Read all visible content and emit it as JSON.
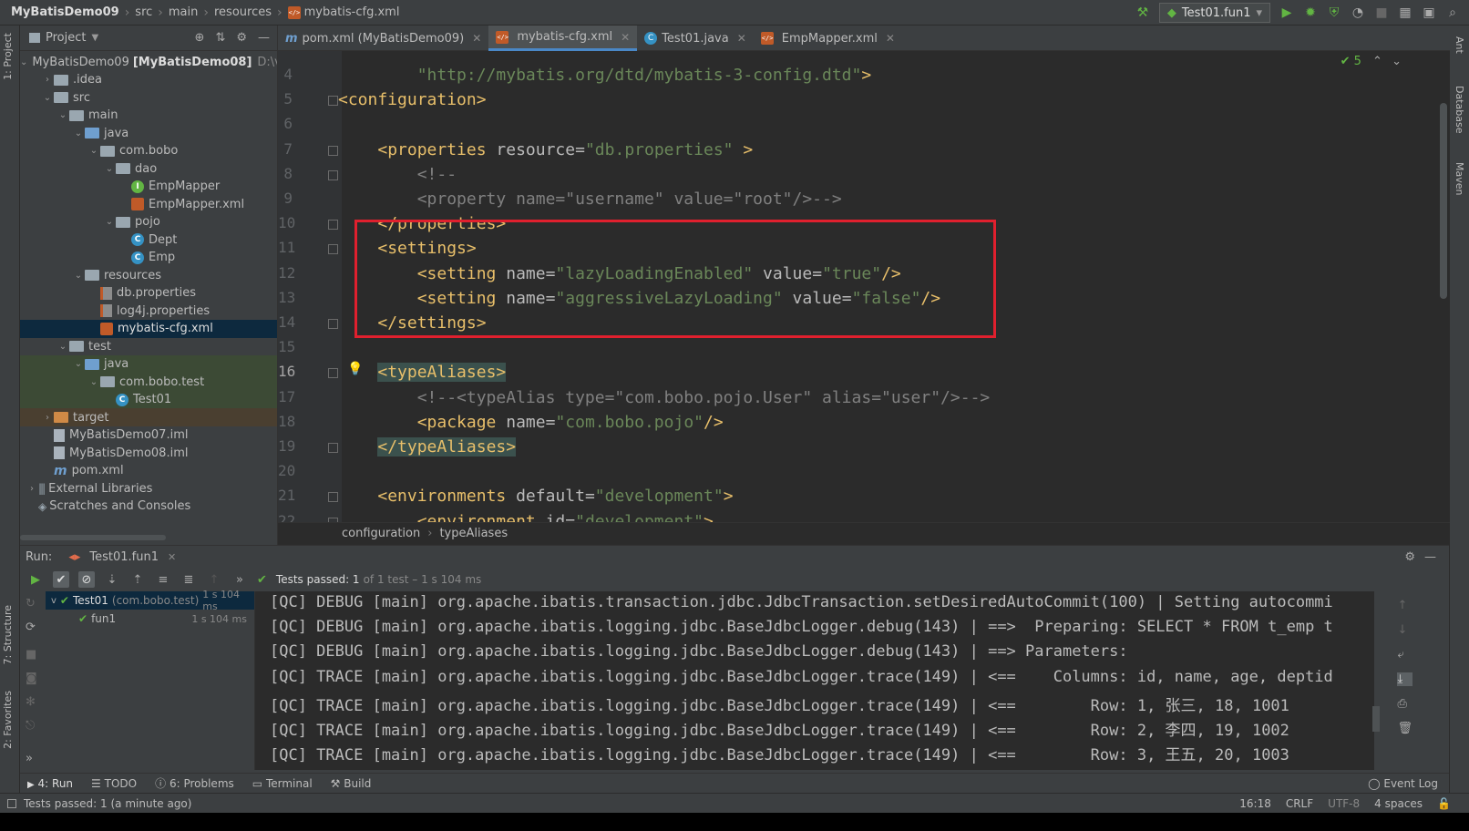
{
  "navbar": {
    "crumbs": [
      "MyBatisDemo09",
      "src",
      "main",
      "resources",
      "mybatis-cfg.xml"
    ],
    "run_config": "Test01.fun1"
  },
  "left_strip": {
    "project_tab": "1: Project",
    "structure_tab": "7: Structure",
    "favorites_tab": "2: Favorites"
  },
  "right_strip": {
    "ant_tab": "Ant",
    "database_tab": "Database",
    "maven_tab": "Maven"
  },
  "project": {
    "title": "Project",
    "tree": [
      {
        "label": "MyBatisDemo09",
        "bold_suffix": "[MyBatisDemo08]",
        "hint": "D:\\v",
        "depth": 0,
        "icon": "folder",
        "arrow": "v"
      },
      {
        "label": ".idea",
        "depth": 1,
        "icon": "folder",
        "arrow": ">"
      },
      {
        "label": "src",
        "depth": 1,
        "icon": "folder",
        "arrow": "v"
      },
      {
        "label": "main",
        "depth": 2,
        "icon": "folder",
        "arrow": "v"
      },
      {
        "label": "java",
        "depth": 3,
        "icon": "folder-blue",
        "arrow": "v"
      },
      {
        "label": "com.bobo",
        "depth": 4,
        "icon": "package",
        "arrow": "v"
      },
      {
        "label": "dao",
        "depth": 5,
        "icon": "package",
        "arrow": "v"
      },
      {
        "label": "EmpMapper",
        "depth": 6,
        "icon": "interface",
        "arrow": ""
      },
      {
        "label": "EmpMapper.xml",
        "depth": 6,
        "icon": "xml",
        "arrow": ""
      },
      {
        "label": "pojo",
        "depth": 5,
        "icon": "package",
        "arrow": "v"
      },
      {
        "label": "Dept",
        "depth": 6,
        "icon": "class",
        "arrow": ""
      },
      {
        "label": "Emp",
        "depth": 6,
        "icon": "class",
        "arrow": ""
      },
      {
        "label": "resources",
        "depth": 3,
        "icon": "folder-res",
        "arrow": "v"
      },
      {
        "label": "db.properties",
        "depth": 4,
        "icon": "properties",
        "arrow": ""
      },
      {
        "label": "log4j.properties",
        "depth": 4,
        "icon": "properties",
        "arrow": ""
      },
      {
        "label": "mybatis-cfg.xml",
        "depth": 4,
        "icon": "xml",
        "arrow": "",
        "selected": true
      },
      {
        "label": "test",
        "depth": 2,
        "icon": "folder",
        "arrow": "v"
      },
      {
        "label": "java",
        "depth": 3,
        "icon": "folder-green",
        "arrow": "v",
        "highlight": "green"
      },
      {
        "label": "com.bobo.test",
        "depth": 4,
        "icon": "package",
        "arrow": "v",
        "highlight": "green"
      },
      {
        "label": "Test01",
        "depth": 5,
        "icon": "class",
        "arrow": "",
        "highlight": "green"
      },
      {
        "label": "target",
        "depth": 1,
        "icon": "folder-orange",
        "arrow": ">",
        "highlight": "brown"
      },
      {
        "label": "MyBatisDemo07.iml",
        "depth": 1,
        "icon": "iml",
        "arrow": ""
      },
      {
        "label": "MyBatisDemo08.iml",
        "depth": 1,
        "icon": "iml",
        "arrow": ""
      },
      {
        "label": "pom.xml",
        "depth": 1,
        "icon": "maven",
        "arrow": ""
      },
      {
        "label": "External Libraries",
        "depth": 0,
        "icon": "library",
        "arrow": ">"
      },
      {
        "label": "Scratches and Consoles",
        "depth": 0,
        "icon": "scratch",
        "arrow": ""
      }
    ]
  },
  "editor": {
    "tabs": [
      {
        "label": "pom.xml (MyBatisDemo09)",
        "icon": "maven"
      },
      {
        "label": "mybatis-cfg.xml",
        "icon": "xml",
        "active": true
      },
      {
        "label": "Test01.java",
        "icon": "class"
      },
      {
        "label": "EmpMapper.xml",
        "icon": "xml"
      }
    ],
    "inspections": "5",
    "lines": [
      {
        "n": "4",
        "text": "        \"http://mybatis.org/dtd/mybatis-3-config.dtd\">"
      },
      {
        "n": "5",
        "text": "<configuration>"
      },
      {
        "n": "6",
        "text": ""
      },
      {
        "n": "7",
        "text": "    <properties resource=\"db.properties\" >"
      },
      {
        "n": "8",
        "text": "        <!--"
      },
      {
        "n": "9",
        "text": "        <property name=\"username\" value=\"root\"/>-->"
      },
      {
        "n": "10",
        "text": "    </properties>"
      },
      {
        "n": "11",
        "text": "    <settings>"
      },
      {
        "n": "12",
        "text": "        <setting name=\"lazyLoadingEnabled\" value=\"true\"/>"
      },
      {
        "n": "13",
        "text": "        <setting name=\"aggressiveLazyLoading\" value=\"false\"/>"
      },
      {
        "n": "14",
        "text": "    </settings>"
      },
      {
        "n": "15",
        "text": ""
      },
      {
        "n": "16",
        "text": "    <typeAliases>"
      },
      {
        "n": "17",
        "text": "        <!--<typeAlias type=\"com.bobo.pojo.User\" alias=\"user\"/>-->"
      },
      {
        "n": "18",
        "text": "        <package name=\"com.bobo.pojo\"/>"
      },
      {
        "n": "19",
        "text": "    </typeAliases>"
      },
      {
        "n": "20",
        "text": ""
      },
      {
        "n": "21",
        "text": "    <environments default=\"development\">"
      },
      {
        "n": "22",
        "text": "        <environment id=\"development\">"
      }
    ],
    "breadcrumb": [
      "configuration",
      "typeAliases"
    ]
  },
  "run": {
    "label": "Run:",
    "tab": "Test01.fun1",
    "status_prefix": "Tests passed: 1",
    "status_suffix": "of 1 test – 1 s 104 ms",
    "tests": [
      {
        "name": "Test01",
        "pkg": "(com.bobo.test)",
        "time": "1 s 104 ms"
      },
      {
        "name": "fun1",
        "time": "1 s 104 ms"
      }
    ],
    "console": [
      "[QC] DEBUG [main] org.apache.ibatis.transaction.jdbc.JdbcTransaction.setDesiredAutoCommit(100) | Setting autocommi",
      "[QC] DEBUG [main] org.apache.ibatis.logging.jdbc.BaseJdbcLogger.debug(143) | ==>  Preparing: SELECT * FROM t_emp t",
      "[QC] DEBUG [main] org.apache.ibatis.logging.jdbc.BaseJdbcLogger.debug(143) | ==> Parameters: ",
      "[QC] TRACE [main] org.apache.ibatis.logging.jdbc.BaseJdbcLogger.trace(149) | <==    Columns: id, name, age, deptid",
      "[QC] TRACE [main] org.apache.ibatis.logging.jdbc.BaseJdbcLogger.trace(149) | <==        Row: 1, 张三, 18, 1001",
      "[QC] TRACE [main] org.apache.ibatis.logging.jdbc.BaseJdbcLogger.trace(149) | <==        Row: 2, 李四, 19, 1002",
      "[QC] TRACE [main] org.apache.ibatis.logging.jdbc.BaseJdbcLogger.trace(149) | <==        Row: 3, 王五, 20, 1003"
    ]
  },
  "bottom_tabs": [
    "4: Run",
    "TODO",
    "6: Problems",
    "Terminal",
    "Build"
  ],
  "event_log": "Event Log",
  "status": {
    "message": "Tests passed: 1 (a minute ago)",
    "position": "16:18",
    "line_sep": "CRLF",
    "encoding": "UTF-8",
    "indent": "4 spaces"
  }
}
